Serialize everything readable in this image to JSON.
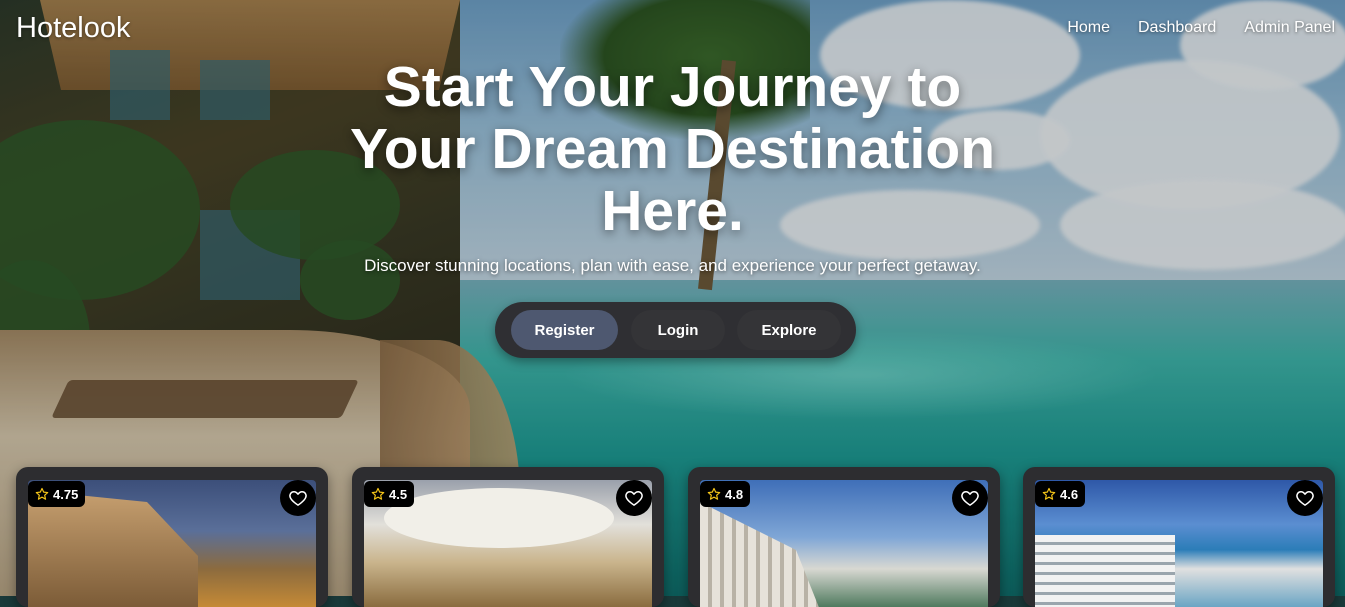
{
  "brand": "Hotelook",
  "nav": [
    {
      "label": "Home"
    },
    {
      "label": "Dashboard"
    },
    {
      "label": "Admin Panel"
    }
  ],
  "hero": {
    "headline": [
      "Start Your Journey to",
      "Your Dream Destination",
      "Here."
    ],
    "subline": "Discover stunning locations, plan with ease, and experience your perfect getaway."
  },
  "cta": {
    "register": "Register",
    "login": "Login",
    "explore": "Explore"
  },
  "cards": [
    {
      "rating": "4.75",
      "icon": "heart-icon"
    },
    {
      "rating": "4.5",
      "icon": "heart-icon"
    },
    {
      "rating": "4.8",
      "icon": "heart-icon"
    },
    {
      "rating": "4.6",
      "icon": "heart-icon"
    }
  ],
  "colors": {
    "cta_group": "#2f2f33",
    "cta_active": "#4e5870",
    "card": "#2d2d30",
    "rating_star": "#f5c518"
  }
}
